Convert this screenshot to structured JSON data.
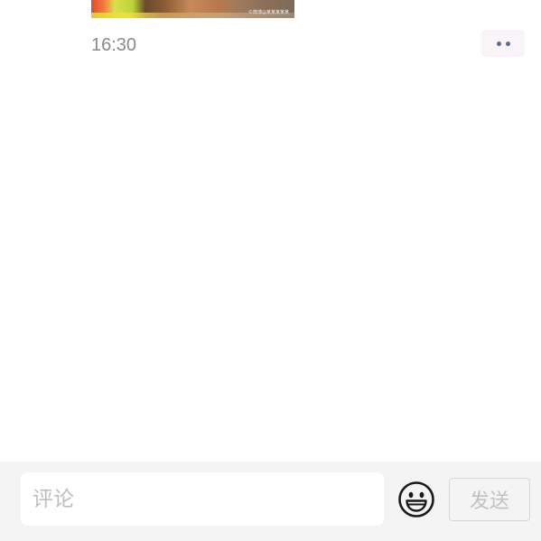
{
  "post": {
    "image_icon": "photo-thumbnail",
    "image_watermark": "©微博@某某某某某",
    "timestamp": "16:30",
    "more_icon": "more-dots-icon",
    "colors": {
      "timestamp": "#8a8a8a",
      "dots": "#5b6b93"
    }
  },
  "comment_bar": {
    "input_value": "",
    "input_placeholder": "评论",
    "emoji_icon": "smiley-emoji-icon",
    "send_label": "发送",
    "colors": {
      "bar_background": "#f4f4f4",
      "send_text": "#c2c2c2",
      "placeholder": "#bdbdbd"
    }
  }
}
